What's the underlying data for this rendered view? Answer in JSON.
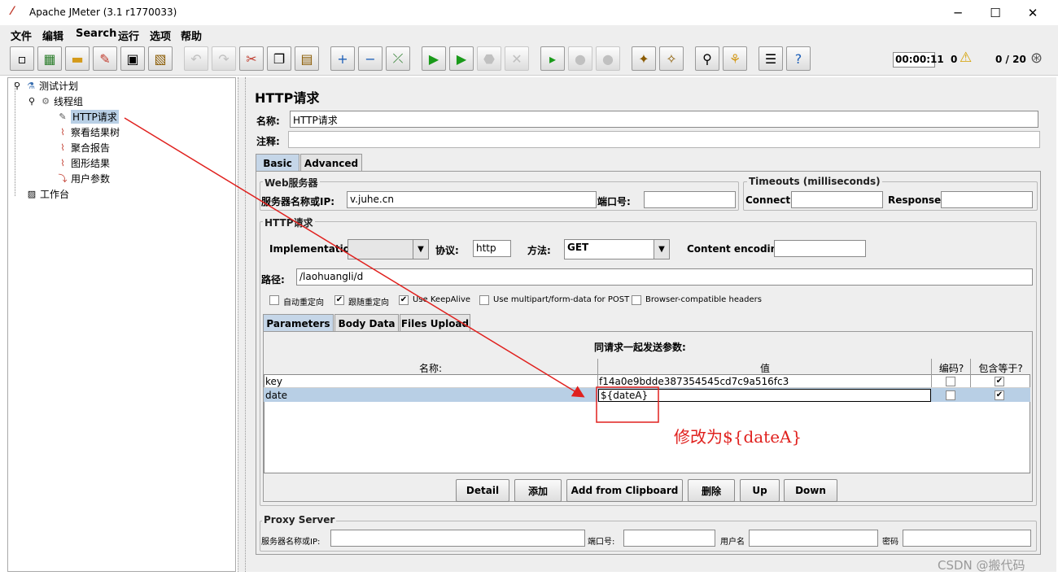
{
  "window": {
    "title": "Apache JMeter (3.1 r1770033)",
    "minimize": "─",
    "maximize": "☐",
    "close": "✕"
  },
  "menu": [
    "文件",
    "编辑",
    "Search",
    "运行",
    "选项",
    "帮助"
  ],
  "toolbar": {
    "timer": "00:00:11",
    "warnings": "0",
    "threads": "0 / 20"
  },
  "tree": {
    "root": "测试计划",
    "thread_group": "线程组",
    "http_request": "HTTP请求",
    "view_results": "察看结果树",
    "aggregate": "聚合报告",
    "graph": "图形结果",
    "user_params": "用户参数",
    "workbench": "工作台"
  },
  "panel": {
    "title": "HTTP请求",
    "name_label": "名称:",
    "name_value": "HTTP请求",
    "comment_label": "注释:",
    "comment_value": "",
    "tabs": [
      "Basic",
      "Advanced"
    ],
    "web_server": {
      "title": "Web服务器",
      "server_label": "服务器名称或IP:",
      "server_value": "v.juhe.cn",
      "port_label": "端口号:",
      "port_value": ""
    },
    "timeouts": {
      "title": "Timeouts (milliseconds)",
      "connect_label": "Connect:",
      "response_label": "Response:"
    },
    "http": {
      "title": "HTTP请求",
      "impl_label": "Implementation:",
      "impl_value": "",
      "protocol_label": "协议:",
      "protocol_value": "http",
      "method_label": "方法:",
      "method_value": "GET",
      "encoding_label": "Content encoding:",
      "encoding_value": "",
      "path_label": "路径:",
      "path_value": "/laohuangli/d"
    },
    "options": [
      {
        "label": "自动重定向",
        "checked": false
      },
      {
        "label": "跟随重定向",
        "checked": true
      },
      {
        "label": "Use KeepAlive",
        "checked": true
      },
      {
        "label": "Use multipart/form-data for POST",
        "checked": false
      },
      {
        "label": "Browser-compatible headers",
        "checked": false
      }
    ],
    "param_tabs": [
      "Parameters",
      "Body Data",
      "Files Upload"
    ],
    "params_caption": "同请求一起发送参数:",
    "columns": [
      "名称:",
      "值",
      "编码?",
      "包含等于?"
    ],
    "rows": [
      {
        "name": "key",
        "value": "f14a0e9bdde387354545cd7c9a516fc3",
        "encode": false,
        "include_equals": true
      },
      {
        "name": "date",
        "value": "${dateA}",
        "encode": false,
        "include_equals": true
      }
    ],
    "buttons": [
      "Detail",
      "添加",
      "Add from Clipboard",
      "删除",
      "Up",
      "Down"
    ],
    "proxy": {
      "title": "Proxy Server",
      "server_label": "服务器名称或IP:",
      "port_label": "端口号:",
      "user_label": "用户名",
      "password_label": "密码"
    }
  },
  "annotation": "修改为${dateA}",
  "watermark": "CSDN @搬代码"
}
